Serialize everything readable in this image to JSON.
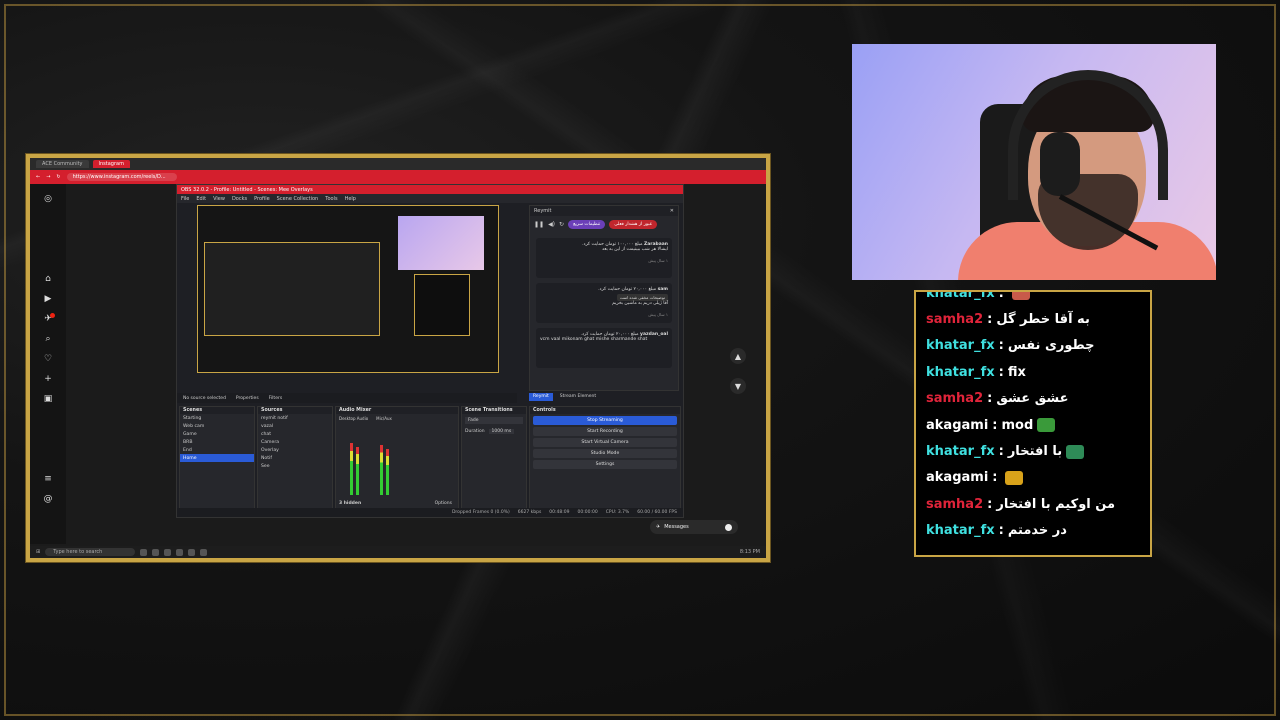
{
  "browser": {
    "tabs": [
      "ACE Community",
      "Instagram"
    ],
    "url": "https://www.instagram.com/reels/D...",
    "obs_title": "OBS 32.0.2 - Profile: Untitled - Scenes: Mee Overlays",
    "obs_menu": [
      "File",
      "Edit",
      "View",
      "Docks",
      "Profile",
      "Scene Collection",
      "Tools",
      "Help"
    ]
  },
  "obs": {
    "no_source": "No source selected",
    "properties": "Properties",
    "filters": "Filters",
    "reymit_title": "Reymit",
    "reymit_btn_purple": "تنظیمات سریع",
    "reymit_btn_red": "عبور از هشدار فعلی",
    "donations": [
      {
        "name": "Zarabaan",
        "amount": "مبلغ ۱۰۰,۰۰۰ تومان حمایت کرد.",
        "text": "ایشالا هر شب ببینیمت از این به بعد",
        "time": "۱ سال پیش"
      },
      {
        "name": "sam",
        "amount": "مبلغ ۲۰,۰۰۰ تومان حمایت کرد.",
        "tag": "توضیحات مخفی شده است",
        "text": "آقا ژیلی دریم به ماشین بخریم",
        "time": "۱ سال پیش"
      },
      {
        "name": "yazdan_oal",
        "amount": "مبلغ ۲۰,۰۰۰ تومان حمایت کرد.",
        "text": "vcm vaal mikonam ghat mishe sharmande shat"
      }
    ],
    "reymit_tabs": [
      "Reymit",
      "Stream Element"
    ],
    "docks": {
      "scenes_title": "Scenes",
      "scenes": [
        "Starting",
        "Web cam",
        "Game",
        "BRB",
        "End",
        "Home"
      ],
      "sources_title": "Sources",
      "sources": [
        "reymit notif",
        "vazal",
        "chat",
        "Camera",
        "Overlay",
        "Notif",
        "See"
      ],
      "mixer_title": "Audio Mixer",
      "mixer_channels": [
        "Desktop Audio",
        "Mic/Aux"
      ],
      "mixer_hidden": "3 hidden",
      "options": "Options",
      "transitions_title": "Scene Transitions",
      "transition": "Fade",
      "duration_label": "Duration",
      "duration": "1000 ms",
      "controls_title": "Controls",
      "controls": [
        "Stop Streaming",
        "Start Recording",
        "Start Virtual Camera",
        "Studio Mode",
        "Settings"
      ]
    },
    "status": {
      "dropped": "Dropped Frames 0 (0.0%)",
      "kbps": "6627 kbps",
      "stream_time": "00:48:09",
      "rec_time": "00:00:00",
      "cpu": "CPU: 3.7%",
      "fps": "60.00 / 60.00 FPS"
    }
  },
  "instagram": {
    "messages_label": "Messages"
  },
  "taskbar": {
    "search_placeholder": "Type here to search",
    "time": "8:13 PM"
  },
  "chat": {
    "messages": [
      {
        "user": "khatar_fx",
        "color": "#3fe0e0",
        "text": "",
        "emote": "#c85a4a"
      },
      {
        "user": "samha2",
        "color": "#e0243a",
        "text": "به آقا خطر گل"
      },
      {
        "user": "khatar_fx",
        "color": "#3fe0e0",
        "text": "چطوری نفس"
      },
      {
        "user": "khatar_fx",
        "color": "#3fe0e0",
        "text": "fix"
      },
      {
        "user": "samha2",
        "color": "#e0243a",
        "text": "عشق عشق"
      },
      {
        "user": "akagami",
        "color": "#ffffff",
        "text": "mod",
        "emote": "#3a9a3a"
      },
      {
        "user": "khatar_fx",
        "color": "#3fe0e0",
        "text": "با افتخار",
        "emote": "#2e8b57"
      },
      {
        "user": "akagami",
        "color": "#ffffff",
        "text": "",
        "emote": "#d8a21a"
      },
      {
        "user": "samha2",
        "color": "#e0243a",
        "text": "من اوکیم با افتخار"
      },
      {
        "user": "khatar_fx",
        "color": "#3fe0e0",
        "text": "در خدمتم"
      }
    ]
  }
}
